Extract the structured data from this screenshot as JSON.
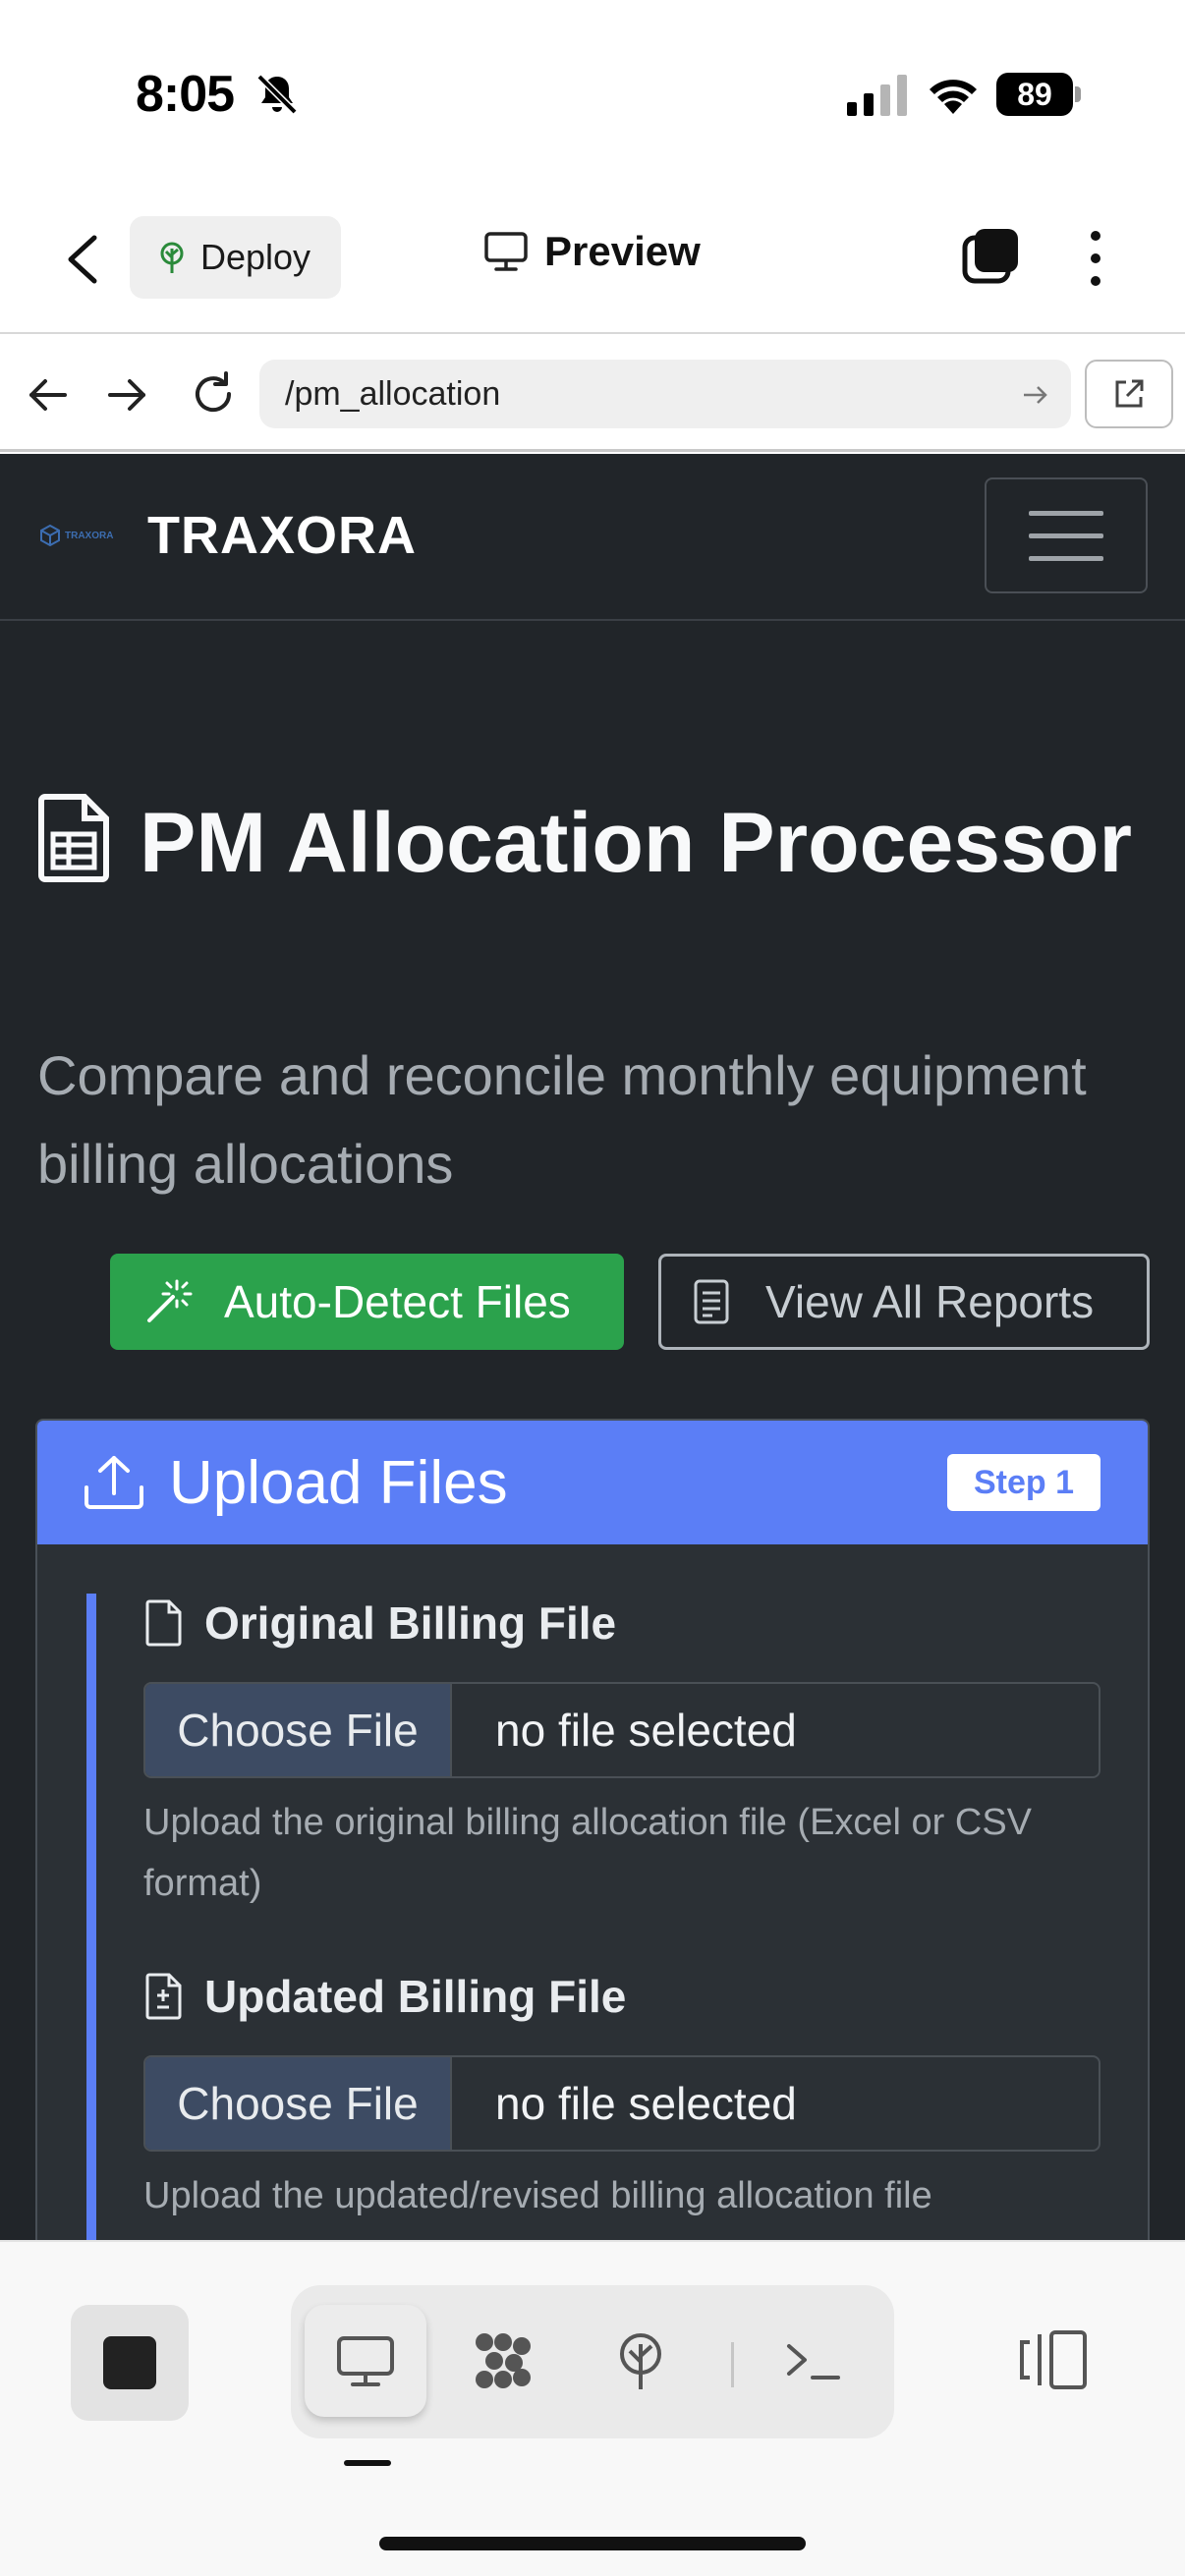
{
  "status_bar": {
    "time": "8:05",
    "battery": "89",
    "icons": [
      "bell-slash-icon",
      "cellular-signal-icon",
      "wifi-icon",
      "battery-icon"
    ]
  },
  "app_bar": {
    "deploy_label": "Deploy",
    "preview_label": "Preview"
  },
  "browser": {
    "url": "/pm_allocation"
  },
  "site": {
    "brand_small": "TRAXORA",
    "brand": "TRAXORA",
    "title": "PM Allocation Processor",
    "subtitle": "Compare and reconcile monthly equipment billing allocations",
    "auto_detect_label": "Auto-Detect Files",
    "view_reports_label": "View All Reports"
  },
  "upload_card": {
    "title": "Upload Files",
    "step_badge": "Step 1",
    "fields": [
      {
        "label": "Original Billing File",
        "choose_label": "Choose File",
        "file_status": "no file selected",
        "help": "Upload the original billing allocation file (Excel or CSV format)"
      },
      {
        "label": "Updated Billing File",
        "choose_label": "Choose File",
        "file_status": "no file selected",
        "help": "Upload the updated/revised billing allocation file"
      }
    ]
  },
  "colors": {
    "page_bg": "#212529",
    "accent_blue": "#5b7ef6",
    "success_green": "#2ba24c"
  }
}
